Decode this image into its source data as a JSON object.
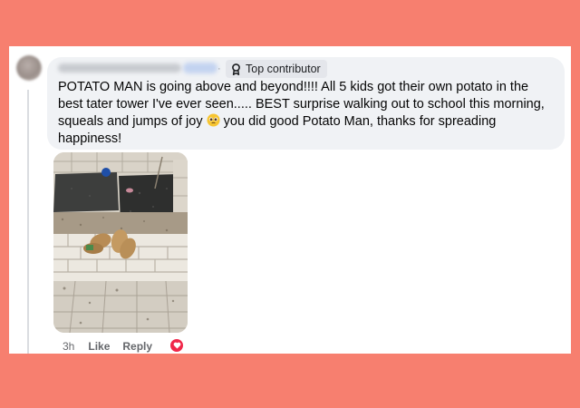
{
  "comment": {
    "badge_label": "Top contributor",
    "text_lines": [
      "POTATO MAN is going above and beyond!!!! All 5 kids got their own potato in the",
      "best tater tower I've ever seen..... BEST surprise walking out to school this morning,",
      "squeals and jumps of joy",
      "you did good Potato Man, thanks for spreading",
      "happiness!"
    ]
  },
  "actions": {
    "time": "3h",
    "like_label": "Like",
    "reply_label": "Reply"
  },
  "reaction": {
    "icon": "heart-icon",
    "color": "#f0284a"
  },
  "colors": {
    "background": "#f77f6f",
    "bubble": "#f0f2f5",
    "secondary_text": "#65676b"
  }
}
